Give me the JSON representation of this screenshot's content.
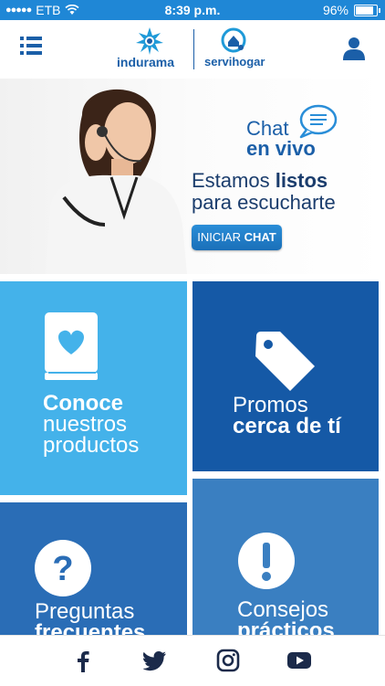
{
  "status_bar": {
    "carrier": "ETB",
    "time": "8:39 p.m.",
    "battery": "96%",
    "battery_level": 0.96
  },
  "header": {
    "brand_primary": "indurama",
    "brand_secondary": "servihogar"
  },
  "banner": {
    "chat_word": "Chat",
    "live_word": "en vivo",
    "tagline_start": "Estamos ",
    "tagline_bold": "listos",
    "tagline_end": "para escucharte",
    "button_light": "INICIAR ",
    "button_bold": "CHAT"
  },
  "tiles": [
    {
      "strong": "Conoce",
      "light1": "nuestros",
      "light2": "productos",
      "icon": "heart-book-icon"
    },
    {
      "light": "Promos",
      "strong": "cerca de tí",
      "icon": "price-tag-icon"
    },
    {
      "light": "Preguntas",
      "strong": "frecuentes",
      "icon": "question-circle-icon"
    },
    {
      "light": "Consejos",
      "strong": "prácticos",
      "icon": "exclamation-circle-icon"
    }
  ],
  "social": [
    "facebook-icon",
    "twitter-icon",
    "instagram-icon",
    "youtube-icon"
  ],
  "colors": {
    "status_bar": "#1f87d6",
    "brand_blue": "#1b5fa8",
    "tile_light_blue": "#44b2ea",
    "tile_dark_blue": "#1559a6",
    "tile_mid_blue": "#2a6db6",
    "tile_soft_blue": "#3a7fc1"
  }
}
